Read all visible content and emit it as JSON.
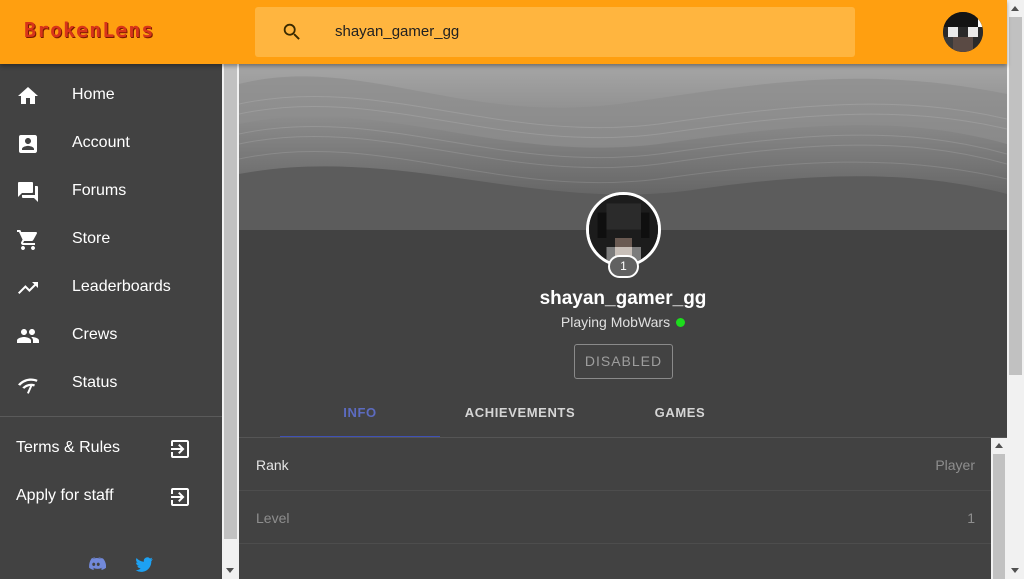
{
  "app": {
    "logo_text": "BrokenLens",
    "accent_color": "#ff9f10"
  },
  "search": {
    "value": "shayan_gamer_gg",
    "icon": "search-icon"
  },
  "sidebar": {
    "items": [
      {
        "label": "Home",
        "icon": "home-icon"
      },
      {
        "label": "Account",
        "icon": "account-box-icon"
      },
      {
        "label": "Forums",
        "icon": "forum-icon"
      },
      {
        "label": "Store",
        "icon": "cart-icon"
      },
      {
        "label": "Leaderboards",
        "icon": "trending-up-icon"
      },
      {
        "label": "Crews",
        "icon": "people-icon"
      },
      {
        "label": "Status",
        "icon": "signal-icon"
      }
    ],
    "links": [
      {
        "label": "Terms & Rules",
        "icon": "exit-to-app-icon"
      },
      {
        "label": "Apply for staff",
        "icon": "exit-to-app-icon"
      }
    ],
    "social": [
      "discord-icon",
      "twitter-icon"
    ]
  },
  "profile": {
    "username": "shayan_gamer_gg",
    "level": "1",
    "status": "Playing MobWars",
    "online_color": "#1ddc1d",
    "button_label": "DISABLED"
  },
  "tabs": [
    {
      "label": "INFO",
      "active": true
    },
    {
      "label": "ACHIEVEMENTS",
      "active": false
    },
    {
      "label": "GAMES",
      "active": false
    }
  ],
  "info_rows": [
    {
      "key": "Rank",
      "value": "Player"
    },
    {
      "key": "Level",
      "value": "1"
    }
  ]
}
